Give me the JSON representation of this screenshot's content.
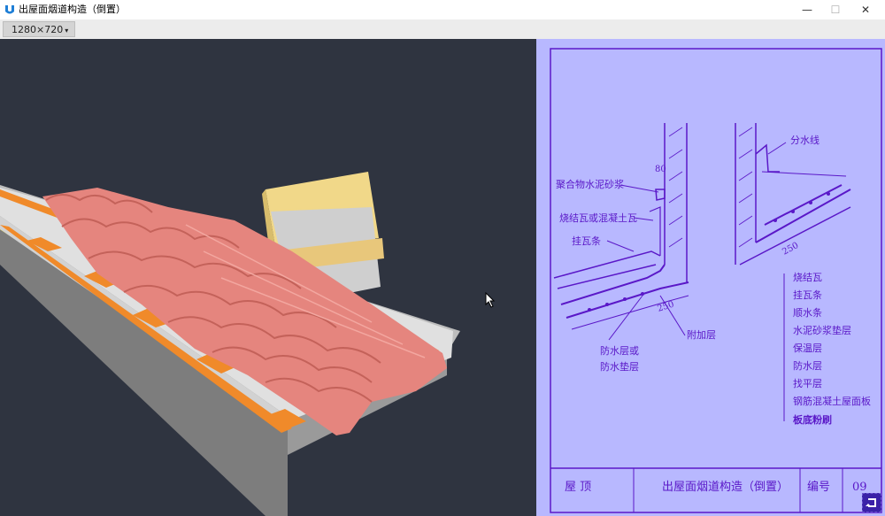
{
  "window": {
    "title": "出屋面烟道构造（倒置）",
    "icon": "app-icon",
    "controls": {
      "minimize": "—",
      "maximize": "☐",
      "close": "✕"
    }
  },
  "toolbar": {
    "resolution": "1280×720",
    "resolution_caret": "▾"
  },
  "viewport": {
    "background": "#2f3440",
    "model": "roof-tile-chimney-3d-model"
  },
  "drawing": {
    "background": "#b8b8ff",
    "line_color": "#5a18c8",
    "left_detail": {
      "labels": [
        "聚合物水泥砂浆",
        "烧结瓦或混凝土瓦",
        "挂瓦条",
        "防水层或",
        "防水垫层",
        "附加层"
      ],
      "dims": [
        "80",
        "250"
      ]
    },
    "right_detail": {
      "top_label": "分水线",
      "dim": "250",
      "layers": [
        "烧结瓦",
        "挂瓦条",
        "顺水条",
        "水泥砂浆垫层",
        "保温层",
        "防水层",
        "找平层",
        "钢筋混凝土屋面板",
        "板底粉刷"
      ]
    },
    "title_block": {
      "category": "屋 顶",
      "name": "出屋面烟道构造（倒置）",
      "code_label": "编号",
      "code": "09"
    }
  }
}
